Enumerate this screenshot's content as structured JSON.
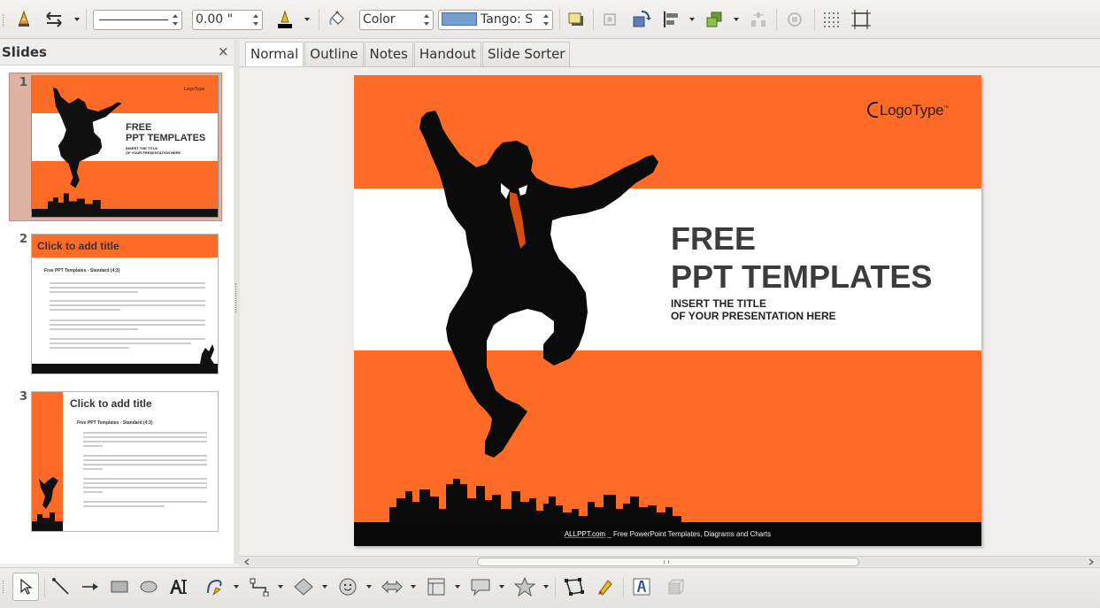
{
  "toolbar": {
    "line_width": "0.00 \"",
    "area_style": "Color",
    "area_fill": "Tango: Sky",
    "area_fill_swatch": "#729fcf"
  },
  "slides_pane": {
    "heading": "Slides",
    "close_glyph": "×",
    "slides": [
      {
        "number": "1",
        "title": "FREE",
        "title2": "PPT TEMPLATES",
        "subtitle": "INSERT THE TITLE",
        "subtitle2": "OF YOUR PRESENTATION HERE",
        "logo": "LogoType"
      },
      {
        "number": "2",
        "title": "Click to add title",
        "subheading": "Free PPT Templates - Standard (4:3)"
      },
      {
        "number": "3",
        "title": "Click to add title",
        "subheading": "Free PPT Templates - Standard (4:3)"
      }
    ]
  },
  "tabs": [
    {
      "label": "Normal",
      "active": true
    },
    {
      "label": "Outline"
    },
    {
      "label": "Notes"
    },
    {
      "label": "Handout"
    },
    {
      "label": "Slide Sorter"
    }
  ],
  "slide": {
    "logo": "LogoType",
    "logo_mark": "™",
    "title_line1": "FREE",
    "title_line2": "PPT TEMPLATES",
    "subtitle_line1": "INSERT THE TITLE",
    "subtitle_line2": "OF YOUR PRESENTATION HERE",
    "footer_link": "ALLPPT.com",
    "footer_rest": " _ Free PowerPoint Templates, Diagrams and Charts",
    "accent_color": "#fd6b26"
  },
  "icons": {
    "top": [
      "line-style-icon",
      "arrow-style-icon",
      "line-color-icon",
      "area-icon",
      "shadow-icon",
      "crop-icon",
      "transformations-icon",
      "align-icon",
      "arrange-icon",
      "distribution-icon",
      "grid-icon",
      "helplines-icon"
    ],
    "bottom": [
      "select-icon",
      "line-icon",
      "arrow-line-icon",
      "rectangle-icon",
      "ellipse-icon",
      "text-icon",
      "curve-icon",
      "connector-icon",
      "basic-shapes-icon",
      "symbol-shapes-icon",
      "block-arrows-icon",
      "flowchart-icon",
      "callouts-icon",
      "stars-icon",
      "points-icon",
      "glue-points-icon",
      "fontwork-icon",
      "extrusion-icon"
    ]
  }
}
